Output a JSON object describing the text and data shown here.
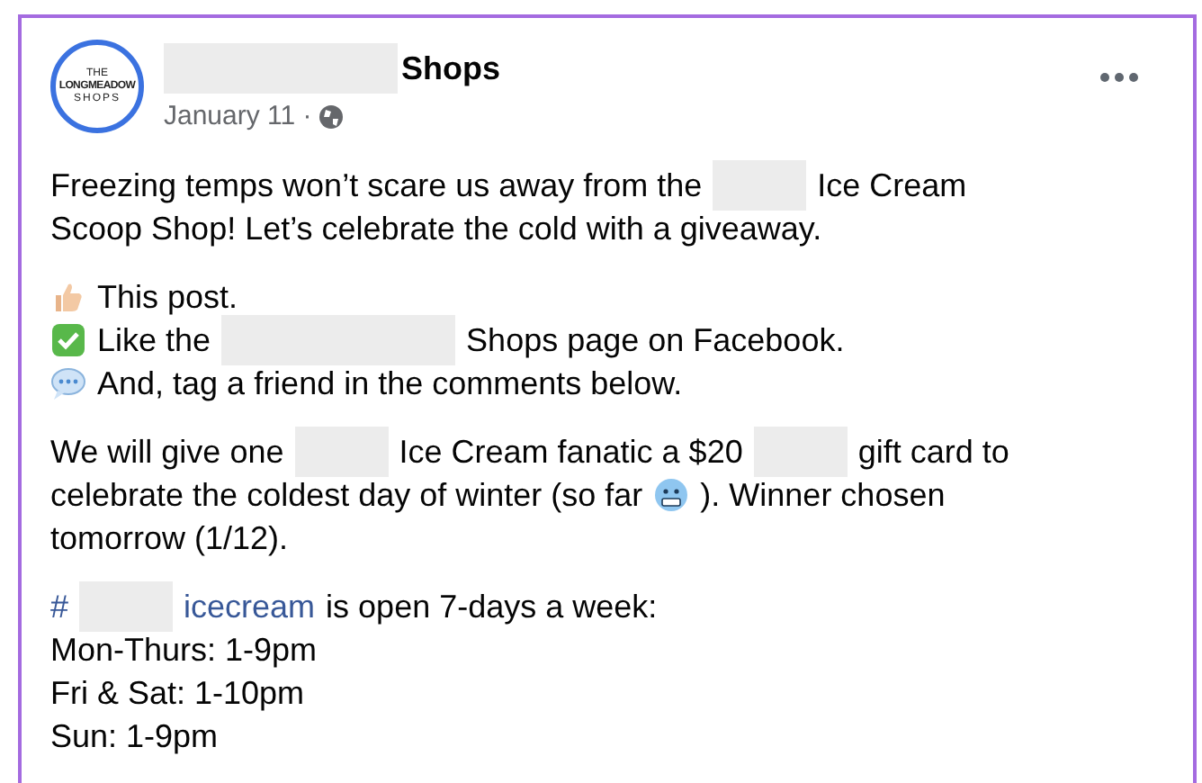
{
  "post": {
    "logo": [
      "THE",
      "LONGMEADOW",
      "SHOPS"
    ],
    "author": [
      {
        "kind": "redacted-long"
      },
      {
        "kind": "text",
        "text": "Shops"
      }
    ],
    "date": "January 11 ·",
    "paragraphs": [
      [
        [
          {
            "kind": "text",
            "text": "Freezing temps won’t scare us away from the"
          },
          {
            "kind": "redacted-short"
          },
          {
            "kind": "text",
            "text": "Ice Cream"
          }
        ],
        [
          {
            "kind": "text",
            "text": "Scoop Shop! Let’s celebrate the cold with a giveaway."
          }
        ]
      ],
      [
        [
          {
            "kind": "thumbs-up"
          },
          {
            "kind": "text",
            "text": "This post."
          }
        ],
        [
          {
            "kind": "check"
          },
          {
            "kind": "text",
            "text": "Like the"
          },
          {
            "kind": "redacted-long"
          },
          {
            "kind": "text",
            "text": "Shops page on Facebook."
          }
        ],
        [
          {
            "kind": "speech"
          },
          {
            "kind": "text",
            "text": "And, tag a friend in the comments below."
          }
        ]
      ],
      [
        [
          {
            "kind": "text",
            "text": "We will give one"
          },
          {
            "kind": "redacted-short"
          },
          {
            "kind": "text",
            "text": "Ice Cream fanatic a $20"
          },
          {
            "kind": "redacted-short"
          },
          {
            "kind": "text",
            "text": "gift card to"
          }
        ],
        [
          {
            "kind": "text",
            "text": "celebrate the coldest day of winter (so far"
          },
          {
            "kind": "cold-face"
          },
          {
            "kind": "text",
            "text": "). Winner chosen"
          }
        ],
        [
          {
            "kind": "text",
            "text": "tomorrow (1/12)."
          }
        ]
      ],
      [
        [
          {
            "kind": "link",
            "text": "#"
          },
          {
            "kind": "redacted-short"
          },
          {
            "kind": "link",
            "text": "icecream"
          },
          {
            "kind": "text",
            "text": "is open 7-days a week:"
          }
        ],
        [
          {
            "kind": "text",
            "text": "Mon-Thurs: 1-9pm"
          }
        ],
        [
          {
            "kind": "text",
            "text": "Fri & Sat: 1-10pm"
          }
        ],
        [
          {
            "kind": "text",
            "text": "Sun: 1-9pm"
          }
        ]
      ]
    ]
  }
}
